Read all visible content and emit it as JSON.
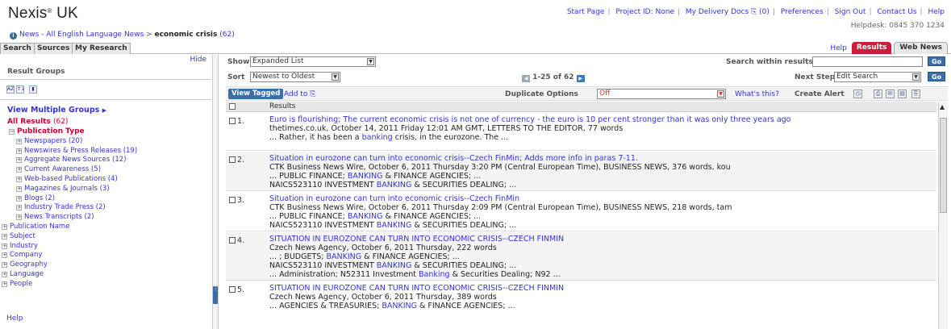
{
  "header": {
    "logo": "Nexis",
    "logo_suffix": "UK",
    "logo_mark": "®",
    "nav": [
      "Start Page",
      "Project ID: None",
      "My Delivery Docs",
      "(0)",
      "Preferences",
      "Sign Out",
      "Contact Us",
      "Help"
    ],
    "helpdesk": "Helpdesk: 0845 370 1234"
  },
  "breadcrumb": {
    "source": "News - All English Language News",
    "separator": ">",
    "query": "economic crisis",
    "count": "(62)"
  },
  "tabs": {
    "left": [
      "Search",
      "Sources",
      "My Research"
    ],
    "help": "Help",
    "results": "Results",
    "web_news": "Web News"
  },
  "sidebar": {
    "hide": "Hide",
    "title": "Result Groups",
    "view_multiple": "View Multiple Groups",
    "all_results": "All Results",
    "all_results_count": "(62)",
    "publication_type": "Publication Type",
    "pub_items": [
      "Newspapers (20)",
      "Newswires & Press Releases (19)",
      "Aggregate News Sources (12)",
      "Current Awareness (5)",
      "Web-based Publications (4)",
      "Magazines & Journals (3)",
      "Blogs (2)",
      "Industry Trade Press (2)",
      "News Transcripts (2)"
    ],
    "groups": [
      "Publication Name",
      "Subject",
      "Industry",
      "Company",
      "Geography",
      "Language",
      "People"
    ],
    "help": "Help"
  },
  "controls": {
    "show_label": "Show",
    "show_value": "Expanded List",
    "sort_label": "Sort",
    "sort_value": "Newest to Oldest",
    "search_within_label": "Search within results",
    "search_within_value": "",
    "go": "Go",
    "pager": "1-25 of 62",
    "next_steps_label": "Next Steps",
    "next_steps_value": "Edit Search"
  },
  "toolbar": {
    "view_tagged": "View Tagged",
    "add_to": "Add to",
    "duplicate_label": "Duplicate Options",
    "duplicate_value": "Off",
    "whats_this": "What's this?",
    "create_alert": "Create Alert"
  },
  "results": {
    "header": "Results",
    "items": [
      {
        "num": "1.",
        "title": "Euro is flourishing; The current economic crisis is not one of currency - the euro is 10 per cent stronger than it was only three years ago",
        "meta": "thetimes.co.uk, October 14, 2011 Friday 12:01 AM GMT, LETTERS TO THE EDITOR, 77 words",
        "snippets": [
          {
            "pre": "... Rather, it has been a ",
            "hl": "banking",
            "post": " crisis, in the eurozone. The ..."
          }
        ]
      },
      {
        "num": "2.",
        "title": "Situation in eurozone can turn into economic crisis--Czech FinMin; Adds more info in paras 7-11.",
        "meta": "CTK Business News Wire, October 6, 2011 Thursday 3:20 PM (Central European Time), BUSINESS NEWS, 376 words, kou",
        "snippets": [
          {
            "pre": "... PUBLIC FINANCE; ",
            "hl": "BANKING",
            "post": " & FINANCE AGENCIES; ..."
          },
          {
            "pre": "NAICS523110 INVESTMENT ",
            "hl": "BANKING",
            "post": " & SECURITIES DEALING; ..."
          }
        ]
      },
      {
        "num": "3.",
        "title": "Situation in eurozone can turn into economic crisis--Czech FinMin",
        "meta": "CTK Business News Wire, October 6, 2011 Thursday 2:09 PM (Central European Time), BUSINESS NEWS, 218 words, tam",
        "snippets": [
          {
            "pre": "... PUBLIC FINANCE; ",
            "hl": "BANKING",
            "post": " & FINANCE AGENCIES; ..."
          },
          {
            "pre": "NAICS523110 INVESTMENT ",
            "hl": "BANKING",
            "post": " & SECURITIES DEALING; ..."
          }
        ]
      },
      {
        "num": "4.",
        "title": "SITUATION IN EUROZONE CAN TURN INTO ECONOMIC CRISIS--CZECH FINMIN",
        "meta": "Czech News Agency, October 6, 2011 Thursday, 222 words",
        "snippets": [
          {
            "pre": "... ; BUDGETS; ",
            "hl": "BANKING",
            "post": " & FINANCE AGENCIES; ..."
          },
          {
            "pre": "NAICS523110 INVESTMENT ",
            "hl": "BANKING",
            "post": " & SECURITIES DEALING; ..."
          },
          {
            "pre": "... Administration; N52311 Investment ",
            "hl": "Banking",
            "post": " & Securities Dealing; N92 ..."
          }
        ]
      },
      {
        "num": "5.",
        "title": "SITUATION IN EUROZONE CAN TURN INTO ECONOMIC CRISIS--CZECH FINMIN",
        "meta": "Czech News Agency, October 6, 2011 Thursday, 389 words",
        "snippets": [
          {
            "pre": "... AGENCIES & TREASURIES; ",
            "hl": "BANKING",
            "post": " & FINANCE AGENCIES; ..."
          }
        ]
      }
    ]
  },
  "colors": {
    "link": "#3333cc",
    "accent_red": "#cc1e3c",
    "button_blue": "#3c6fa8"
  }
}
